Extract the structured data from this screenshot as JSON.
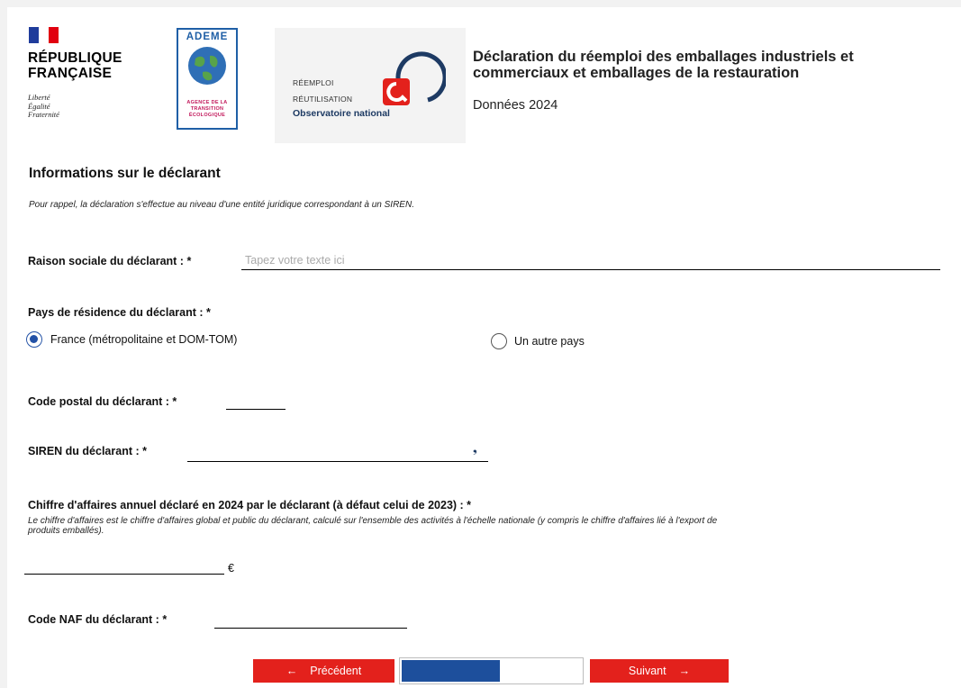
{
  "header": {
    "rf_lines": [
      "RÉPUBLIQUE",
      "FRANÇAISE"
    ],
    "rf_motto": [
      "Liberté",
      "Égalité",
      "Fraternité"
    ],
    "ademe_name": "ADEME",
    "ademe_sub": [
      "AGENCE DE LA",
      "TRANSITION",
      "ÉCOLOGIQUE"
    ],
    "obs_line1": "RÉEMPLOI",
    "obs_line2": "RÉUTILISATION",
    "obs_name": "Observatoire national",
    "title_line1": "Déclaration du réemploi des emballages industriels et",
    "title_line2": "commerciaux et emballages de la restauration",
    "year": "Données 2024"
  },
  "form": {
    "section_title": "Informations sur le déclarant",
    "note": "Pour rappel, la déclaration s'effectue au niveau d'une entité juridique correspondant à un SIREN.",
    "raison_label": "Raison sociale du déclarant : *",
    "raison_placeholder": "Tapez votre texte ici",
    "raison_value": "",
    "pays_label": "Pays de résidence du déclarant : *",
    "pays_options": [
      "France (métropolitaine et DOM-TOM)",
      "Un autre pays"
    ],
    "pays_selected": 0,
    "cp_label": "Code postal du déclarant : *",
    "siren_label": "SIREN du déclarant : *",
    "ca_label": "Chiffre d'affaires annuel déclaré en 2024 par le déclarant (à défaut celui de 2023) : *",
    "ca_help_line1": "Le chiffre d'affaires est le chiffre d'affaires global et public du déclarant, calculé sur l'ensemble des activités à l'échelle nationale (y compris le chiffre d'affaires lié à l'export de",
    "ca_help_line2": "produits emballés).",
    "currency": "€",
    "naf_label": "Code NAF du déclarant : *"
  },
  "nav": {
    "prev_label": "Précédent",
    "next_label": "Suivant",
    "progress_fraction": 0.55
  },
  "colors": {
    "accent_red": "#e3211c",
    "navy": "#1d4f9c",
    "radio_blue": "#2251a6"
  }
}
